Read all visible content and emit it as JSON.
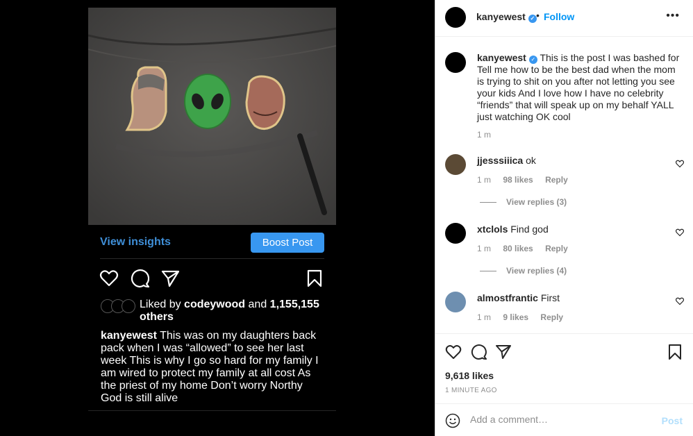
{
  "phone": {
    "view_insights": "View insights",
    "boost_post": "Boost Post",
    "liked_by_prefix": "Liked by",
    "liked_by_user": "codeywood",
    "liked_by_and": "and",
    "liked_by_count": "1,155,155",
    "liked_by_others": "others",
    "caption_user": "kanyewest",
    "caption_text": "This was on my daughters back pack when I was “allowed” to see her last week  This is why I go so hard for my family I am wired to protect my family at all cost  As the priest of my home  Don’t worry Northy  God is still alive",
    "icons": [
      "heart-icon",
      "comment-icon",
      "share-icon",
      "bookmark-icon"
    ]
  },
  "post": {
    "username": "kanyewest",
    "verified_mark": "✓",
    "separator": "•",
    "follow": "Follow",
    "more": "•••",
    "caption_user": "kanyewest",
    "caption_text": "This is the post I was bashed for Tell me how to be the best dad when the mom is trying to shit on you after not letting you see your kids And I love how I have no celebrity “friends” that will speak up on my behalf YALL just watching OK cool",
    "caption_time": "1 m",
    "comments": [
      {
        "user": "jjesssiiica",
        "text": "ok",
        "time": "1 m",
        "likes": "98 likes",
        "reply": "Reply",
        "view_replies": "View replies (3)"
      },
      {
        "user": "xtclols",
        "text": "Find god",
        "time": "1 m",
        "likes": "80 likes",
        "reply": "Reply",
        "view_replies": "View replies (4)"
      },
      {
        "user": "almostfrantic",
        "text": "First",
        "time": "1 m",
        "likes": "9 likes",
        "reply": "Reply",
        "view_replies": ""
      }
    ],
    "likes": "9,618 likes",
    "time_ago": "1 MINUTE AGO",
    "add_comment_placeholder": "Add a comment…",
    "post_button": "Post"
  },
  "colors": {
    "link_blue": "#0095f6",
    "boost_blue": "#3897f0",
    "insights_blue": "#3f8fd8",
    "muted": "#8e8e8e"
  }
}
